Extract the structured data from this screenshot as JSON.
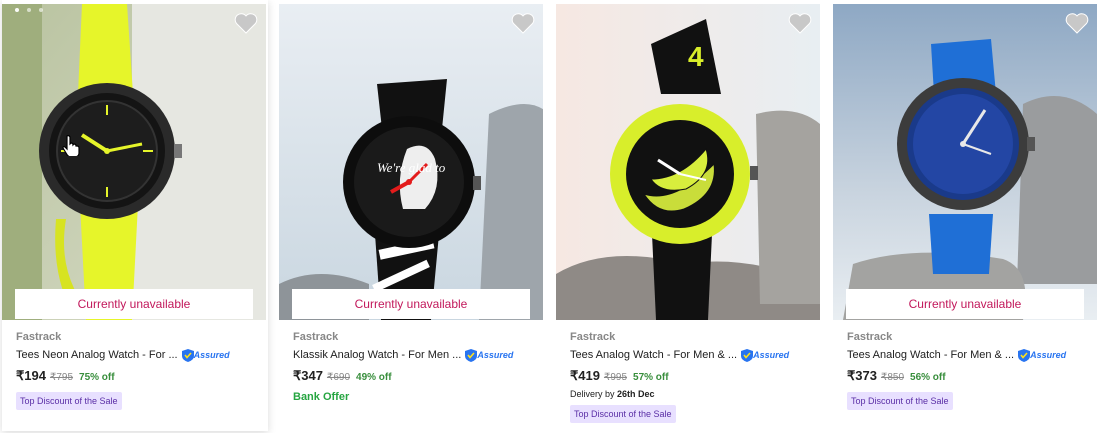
{
  "products": [
    {
      "brand": "Fastrack",
      "title": "Tees Neon Analog Watch - For ...",
      "assured": "Assured",
      "price": "₹194",
      "mrp": "₹795",
      "discount": "75% off",
      "status": "Currently unavailable",
      "extra_type": "badge",
      "extra": "Top Discount of the Sale"
    },
    {
      "brand": "Fastrack",
      "title": "Klassik Analog Watch - For Men ...",
      "assured": "Assured",
      "price": "₹347",
      "mrp": "₹690",
      "discount": "49% off",
      "status": "Currently unavailable",
      "extra_type": "bank",
      "extra": "Bank Offer",
      "dial_text": {
        "top": "drink in ANYTIME",
        "left": "We're glad to",
        "right": "SEE YOU'RE BACK"
      }
    },
    {
      "brand": "Fastrack",
      "title": "Tees Analog Watch - For Men & ...",
      "assured": "Assured",
      "price": "₹419",
      "mrp": "₹995",
      "discount": "57% off",
      "delivery_prefix": "Delivery by",
      "delivery_date": "26th Dec",
      "extra_type": "badge",
      "extra": "Top Discount of the Sale",
      "strap_text": "4"
    },
    {
      "brand": "Fastrack",
      "title": "Tees Analog Watch - For Men & ...",
      "assured": "Assured",
      "price": "₹373",
      "mrp": "₹850",
      "discount": "56% off",
      "status": "Currently unavailable",
      "extra_type": "badge",
      "extra": "Top Discount of the Sale"
    }
  ],
  "colors": {
    "unavailable": "#c2185b",
    "discount": "#388e3c",
    "assured": "#2874f0",
    "badge_bg": "#e8e0ff",
    "bank_offer": "#26a541"
  },
  "icons": {
    "wishlist": "heart-icon",
    "assured": "assured-badge-icon",
    "cursor": "hand-cursor-icon"
  }
}
